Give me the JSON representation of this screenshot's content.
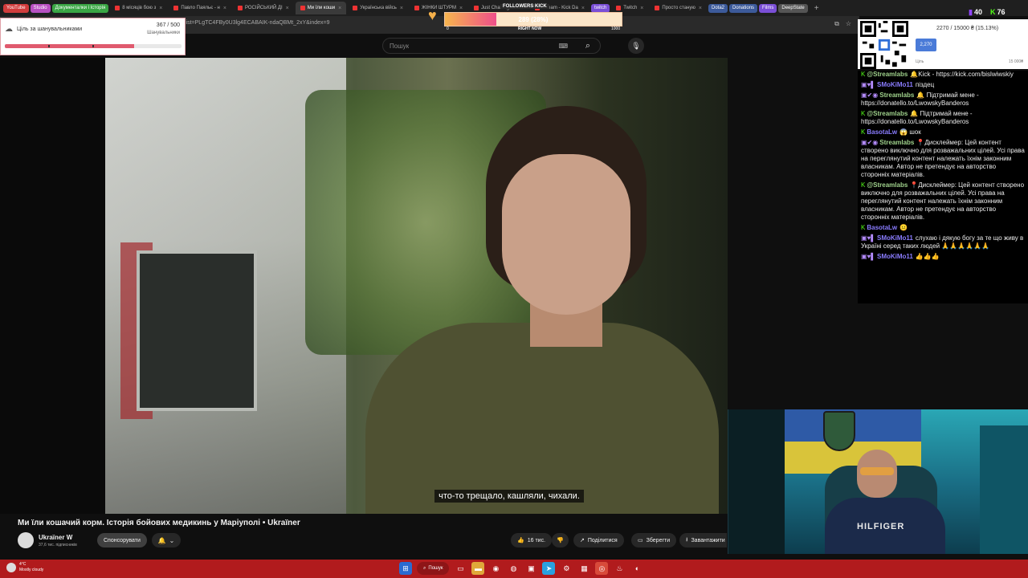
{
  "browser": {
    "tabs": [
      {
        "label": "YouTube",
        "style": "pill",
        "color": "#d23c3c"
      },
      {
        "label": "Studio",
        "style": "pill",
        "color": "#b84fc1"
      },
      {
        "label": "Документалки і Історія",
        "style": "pill",
        "color": "#3aa544"
      },
      {
        "label": "8 місяців бою з",
        "style": "tab"
      },
      {
        "label": "Павло Паяльє - н",
        "style": "tab"
      },
      {
        "label": "РОСІЙСЬКИЙ ДІ",
        "style": "tab"
      },
      {
        "label": "Ми їли коши",
        "style": "tab",
        "active": true
      },
      {
        "label": "Українська війсь",
        "style": "tab"
      },
      {
        "label": "ЖІНКИ ШТУРМ",
        "style": "tab"
      },
      {
        "label": "Just Chatting Str",
        "style": "tab"
      },
      {
        "label": "Stream - Kick Da",
        "style": "tab"
      },
      {
        "label": "twitch",
        "style": "pill",
        "color": "#7a4fd6"
      },
      {
        "label": "Twitch",
        "style": "tab"
      },
      {
        "label": "Просто станую",
        "style": "tab"
      },
      {
        "label": "Dota2",
        "style": "pill",
        "color": "#3c5a9a"
      },
      {
        "label": "Donations",
        "style": "pill",
        "color": "#3c5a9a"
      },
      {
        "label": "Films",
        "style": "pill",
        "color": "#7a4fd6"
      },
      {
        "label": "DeepState",
        "style": "pill",
        "color": "#555555"
      }
    ],
    "url": "list=PLgTC4FBy0U3lg4ECABAIK-ndaQBMt_2xY&index=9"
  },
  "youtube": {
    "search_placeholder": "Пошук",
    "video_title": "Ми їли кошачий корм. Історія бойових медикинь у Маріуполі • Ukraїner",
    "subtitle": "что-то трещало, кашляли, чихали.",
    "channel": {
      "name": "Ukraїner W",
      "subs": "37,6 тис. підписників"
    },
    "sponsor_label": "Спонсорувати",
    "actions": {
      "likes": "16 тис.",
      "share": "Поділитися",
      "save": "Зберегти",
      "download": "Завантажити"
    }
  },
  "goal_widget": {
    "label": "Ціль за шанувальниками",
    "count": "367 / 500",
    "sub": "Шанувальники",
    "progress": 0.734,
    "accent": "#e05a6e"
  },
  "followers_kick": {
    "title": "FOLLOWERS KICK",
    "value_text": "289 (28%)",
    "progress": 0.289,
    "min": "0",
    "max": "1000",
    "mid_label": "RIGHT NOW"
  },
  "counters": {
    "twitch": "40",
    "kick": "76"
  },
  "donation_goal": {
    "text": "2270 / 15000 ₴ (15.13%)",
    "badge": "2,270",
    "min_label": "Ціль",
    "max_label": "15 000₴"
  },
  "chat": [
    {
      "badges": "K",
      "badge_type": "kick",
      "user": "@Streamlabs",
      "user_color": "u-green",
      "text": "🔔Kick - https://kick.com/bislwiwskiy"
    },
    {
      "badges": "▣♥▌",
      "badge_type": "tw",
      "user": "SMoKiMo11",
      "user_color": "u-purple",
      "text": "піздец"
    },
    {
      "badges": "▣✔◉",
      "badge_type": "tw",
      "user": "Streamlabs",
      "user_color": "u-green",
      "text": "🔔 Підтримай мене - https://donatello.to/LwowskyBanderos"
    },
    {
      "badges": "K",
      "badge_type": "kick",
      "user": "@Streamlabs",
      "user_color": "u-green",
      "text": "🔔 Підтримай мене - https://donatello.to/LwowskyBanderos"
    },
    {
      "badges": "K",
      "badge_type": "kick",
      "user": "BasotaLw",
      "user_color": "u-purple",
      "text": "😱 шок"
    },
    {
      "badges": "▣✔◉",
      "badge_type": "tw",
      "user": "Streamlabs",
      "user_color": "u-green",
      "text": "📍Дисклеймер: Цей контент створено виключно для розважальних цілей. Усі права на переглянутий контент належать їхнім законним власникам. Автор не претендує на авторство сторонніх матеріалів."
    },
    {
      "badges": "K",
      "badge_type": "kick",
      "user": "@Streamlabs",
      "user_color": "u-green",
      "text": "📍Дисклеймер: Цей контент створено виключно для розважальних цілей. Усі права на переглянутий контент належать їхнім законним власникам. Автор не претендує на авторство сторонніх матеріалів."
    },
    {
      "badges": "K",
      "badge_type": "kick",
      "user": "BasotaLw",
      "user_color": "u-purple",
      "text": "😐"
    },
    {
      "badges": "▣♥▌",
      "badge_type": "tw",
      "user": "SMoKiMo11",
      "user_color": "u-purple",
      "text": "слухаю і дякую богу за те що живу в Україні серед таких людей 🙏🙏🙏🙏🙏🙏"
    },
    {
      "badges": "▣♥▌",
      "badge_type": "tw",
      "user": "SMoKiMo11",
      "user_color": "u-purple",
      "text": "👍👍👍"
    }
  ],
  "taskbar": {
    "temp": "4°C",
    "weather": "Mostly cloudy",
    "search_label": "Пошук"
  }
}
